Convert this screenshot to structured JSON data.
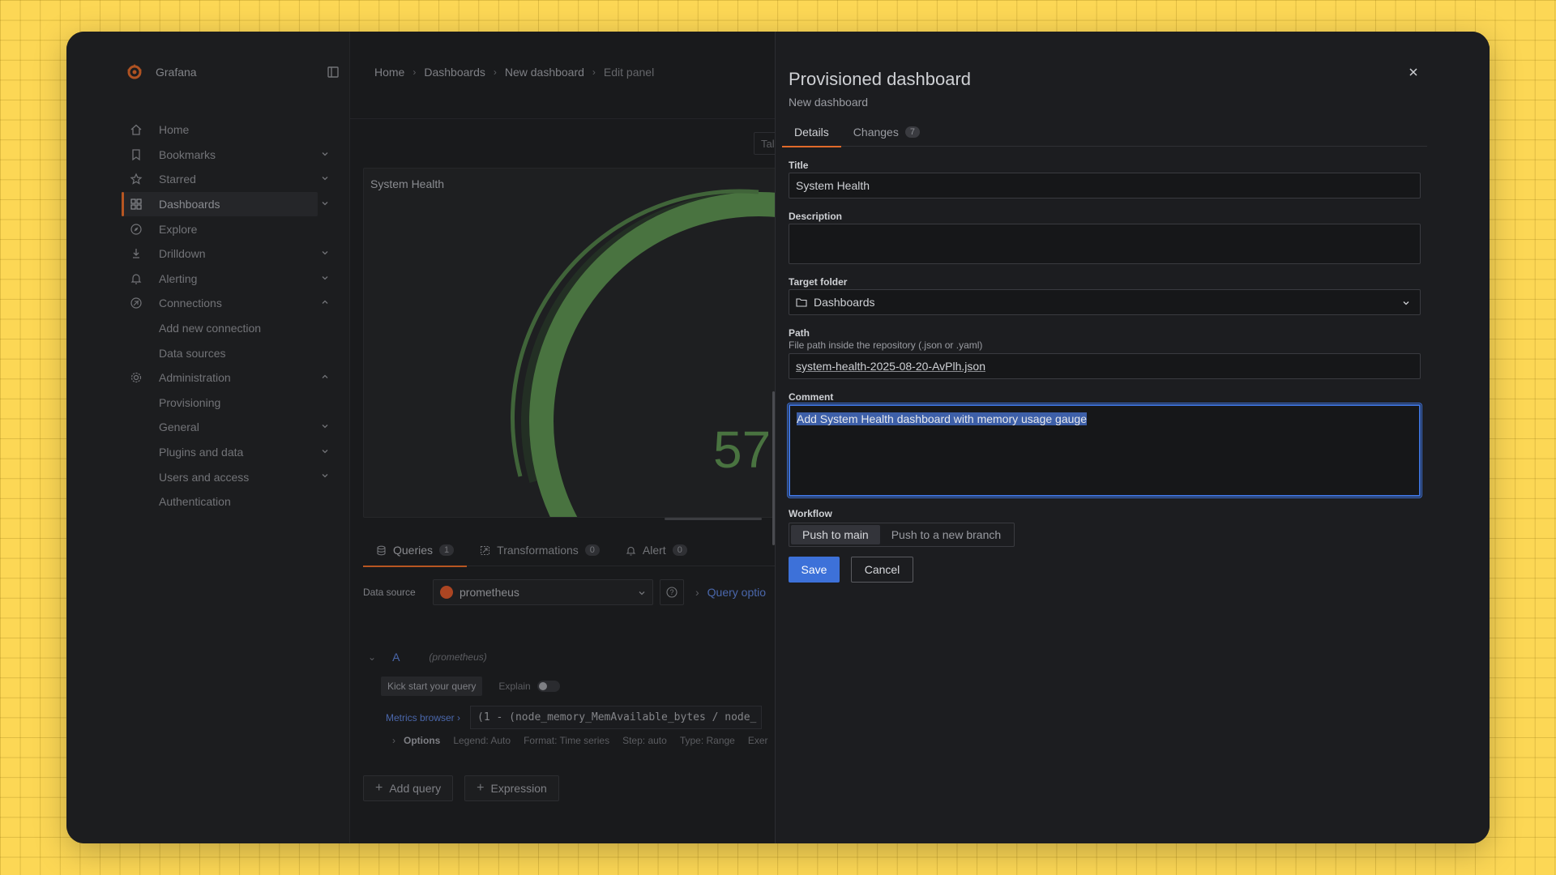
{
  "app": {
    "name": "Grafana"
  },
  "colors": {
    "accent": "#e06a2a",
    "primary": "#3d71d9",
    "gauge": "#5a8d4f"
  },
  "sidebar": {
    "items": [
      {
        "label": "Home",
        "icon": "home-icon"
      },
      {
        "label": "Bookmarks",
        "icon": "bookmark-icon"
      },
      {
        "label": "Starred",
        "icon": "star-icon"
      },
      {
        "label": "Dashboards",
        "icon": "grid-icon",
        "active": true
      },
      {
        "label": "Explore",
        "icon": "compass-icon"
      },
      {
        "label": "Drilldown",
        "icon": "drilldown-icon"
      },
      {
        "label": "Alerting",
        "icon": "bell-icon"
      },
      {
        "label": "Connections",
        "icon": "link-icon",
        "expanded": true
      },
      {
        "label": "Add new connection"
      },
      {
        "label": "Data sources"
      },
      {
        "label": "Administration",
        "icon": "cog-icon",
        "expanded": true
      },
      {
        "label": "Provisioning"
      },
      {
        "label": "General"
      },
      {
        "label": "Plugins and data"
      },
      {
        "label": "Users and access"
      },
      {
        "label": "Authentication"
      }
    ]
  },
  "breadcrumb": [
    "Home",
    "Dashboards",
    "New dashboard",
    "Edit panel"
  ],
  "toolbar": {
    "table_toggle": "Tal"
  },
  "panel": {
    "title": "System Health",
    "gauge_value": "57",
    "gauge_fraction": 0.57
  },
  "query_tabs": [
    {
      "label": "Queries",
      "count": "1"
    },
    {
      "label": "Transformations",
      "count": "0"
    },
    {
      "label": "Alert",
      "count": "0"
    }
  ],
  "datasource": {
    "label": "Data source",
    "value": "prometheus",
    "query_options": "Query optio"
  },
  "query": {
    "letter": "A",
    "datasource": "(prometheus)",
    "kick_start": "Kick start your query",
    "explain": "Explain",
    "metrics_browser": "Metrics browser ›",
    "expr": "(1 - (node_memory_MemAvailable_bytes / node_",
    "options_label": "Options",
    "legend": "Legend: Auto",
    "format": "Format: Time series",
    "step": "Step: auto",
    "type": "Type: Range",
    "exemplars": "Exer"
  },
  "add_buttons": {
    "add_query": "Add query",
    "expression": "Expression"
  },
  "drawer": {
    "title": "Provisioned dashboard",
    "subtitle": "New dashboard",
    "tabs": [
      {
        "label": "Details"
      },
      {
        "label": "Changes",
        "count": "7"
      }
    ],
    "title_label": "Title",
    "title_value": "System Health",
    "description_label": "Description",
    "description_value": "",
    "folder_label": "Target folder",
    "folder_value": "Dashboards",
    "path_label": "Path",
    "path_hint": "File path inside the repository (.json or .yaml)",
    "path_value": "system-health-2025-08-20-AvPlh.json",
    "comment_label": "Comment",
    "comment_value": "Add System Health dashboard with memory usage gauge",
    "workflow_label": "Workflow",
    "workflow_options": [
      "Push to main",
      "Push to a new branch"
    ],
    "save": "Save",
    "cancel": "Cancel"
  }
}
